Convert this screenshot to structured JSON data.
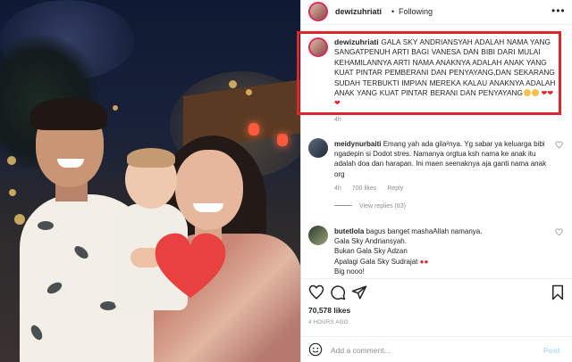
{
  "post": {
    "username": "dewizuhriati",
    "separator": "•",
    "follow_status": "Following",
    "more_glyph": "•••"
  },
  "caption": {
    "username": "dewizuhriati",
    "text": "GALA SKY ANDRIANSYAH ADALAH NAMA YANG SANGATPENUH ARTI BAGI VANESA DAN BIBI DARI MULAI KEHAMILANNYA ARTI NAMA ANAKNYA ADALAH ANAK YANG KUAT PINTAR PEMBERANI DAN PENYAYANG,DAN SEKARANG SUDAH TERBUKTI IMPIAN MEREKA KALAU ANAKNYA ADALAH ANAK YANG KUAT PINTAR BERANI DAN PENYAYANG",
    "time": "4h"
  },
  "comments": [
    {
      "username": "meidynurbaiti",
      "text": "Emang yah ada gila²nya. Yg sabar ya keluarga bibi ngadepin si Dodot stres. Namanya orgtua ksh nama ke anak itu adalah doa dan harapan. Ini maen seenaknya aja ganti nama anak org",
      "time": "4h",
      "likes": "700 likes",
      "reply": "Reply",
      "view_replies": "View replies (83)"
    },
    {
      "username": "butetlola",
      "lines": [
        "bagus banget mashaAllah namanya.",
        "Gala Sky Andriansyah.",
        "Bukan Gala Sky Adzan",
        "Apalagi Gala Sky Sudrajat",
        "Big nooo!"
      ]
    }
  ],
  "stats": {
    "likes": "70,578 likes",
    "posted": "4 HOURS AGO"
  },
  "add_comment": {
    "placeholder": "Add a comment...",
    "post_label": "Post"
  },
  "colors": {
    "highlight_border": "#e0262b",
    "text": "#262626",
    "muted": "#8e8e8e",
    "post_disabled": "#b3dbff"
  },
  "icons": {
    "like": "heart-outline-icon",
    "comment": "comment-bubble-icon",
    "share": "paper-plane-icon",
    "save": "bookmark-icon",
    "emoji": "smiley-icon",
    "comment_like": "small-heart-icon"
  }
}
